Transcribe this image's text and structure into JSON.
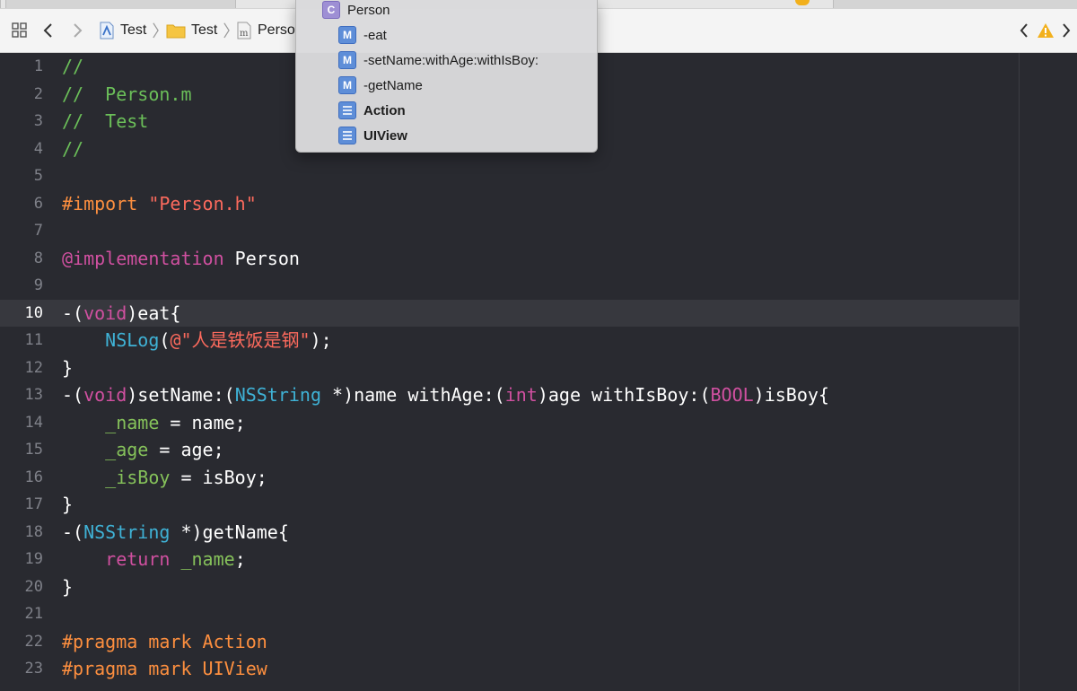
{
  "jumpbar": {
    "crumbs": [
      {
        "label": "Test",
        "icon": "project-icon"
      },
      {
        "label": "Test",
        "icon": "folder-icon"
      },
      {
        "label": "Perso",
        "icon": "m-file-icon"
      }
    ]
  },
  "popup": {
    "items": [
      {
        "label": "Person",
        "kind": "C",
        "icon": "class-icon"
      },
      {
        "label": "-eat",
        "kind": "M",
        "icon": "method-icon"
      },
      {
        "label": "-setName:withAge:withIsBoy:",
        "kind": "M",
        "icon": "method-icon"
      },
      {
        "label": "-getName",
        "kind": "M",
        "icon": "method-icon"
      },
      {
        "label": "Action",
        "kind": "mark",
        "icon": "pragma-mark-icon"
      },
      {
        "label": "UIView",
        "kind": "mark",
        "icon": "pragma-mark-icon"
      }
    ]
  },
  "editor": {
    "current_line": 10,
    "lines": [
      {
        "n": "1",
        "tokens": [
          [
            "//",
            "comment"
          ]
        ]
      },
      {
        "n": "2",
        "tokens": [
          [
            "//  Person.m",
            "comment"
          ]
        ]
      },
      {
        "n": "3",
        "tokens": [
          [
            "//  Test",
            "comment"
          ]
        ]
      },
      {
        "n": "4",
        "tokens": [
          [
            "//",
            "comment"
          ]
        ]
      },
      {
        "n": "5",
        "tokens": []
      },
      {
        "n": "6",
        "tokens": [
          [
            "#import ",
            "pre"
          ],
          [
            "\"Person.h\"",
            "str"
          ]
        ]
      },
      {
        "n": "7",
        "tokens": []
      },
      {
        "n": "8",
        "tokens": [
          [
            "@implementation",
            "kw"
          ],
          [
            " Person",
            "plain"
          ]
        ]
      },
      {
        "n": "9",
        "tokens": []
      },
      {
        "n": "10",
        "tokens": [
          [
            "-(",
            "plain"
          ],
          [
            "void",
            "kw"
          ],
          [
            ")eat{",
            "plain"
          ]
        ]
      },
      {
        "n": "11",
        "tokens": [
          [
            "    ",
            "plain"
          ],
          [
            "NSLog",
            "type"
          ],
          [
            "(",
            "plain"
          ],
          [
            "@\"人是铁饭是钢\"",
            "str"
          ],
          [
            ");",
            "plain"
          ]
        ]
      },
      {
        "n": "12",
        "tokens": [
          [
            "}",
            "plain"
          ]
        ]
      },
      {
        "n": "13",
        "tokens": [
          [
            "-(",
            "plain"
          ],
          [
            "void",
            "kw"
          ],
          [
            ")setName:(",
            "plain"
          ],
          [
            "NSString",
            "type"
          ],
          [
            " *)name withAge:(",
            "plain"
          ],
          [
            "int",
            "kw"
          ],
          [
            ")age withIsBoy:(",
            "plain"
          ],
          [
            "BOOL",
            "kw"
          ],
          [
            ")isBoy{",
            "plain"
          ]
        ]
      },
      {
        "n": "14",
        "tokens": [
          [
            "    ",
            "plain"
          ],
          [
            "_name",
            "ivar"
          ],
          [
            " = name;",
            "plain"
          ]
        ]
      },
      {
        "n": "15",
        "tokens": [
          [
            "    ",
            "plain"
          ],
          [
            "_age",
            "ivar"
          ],
          [
            " = age;",
            "plain"
          ]
        ]
      },
      {
        "n": "16",
        "tokens": [
          [
            "    ",
            "plain"
          ],
          [
            "_isBoy",
            "ivar"
          ],
          [
            " = isBoy;",
            "plain"
          ]
        ]
      },
      {
        "n": "17",
        "tokens": [
          [
            "}",
            "plain"
          ]
        ]
      },
      {
        "n": "18",
        "tokens": [
          [
            "-(",
            "plain"
          ],
          [
            "NSString",
            "type"
          ],
          [
            " *)getName{",
            "plain"
          ]
        ]
      },
      {
        "n": "19",
        "tokens": [
          [
            "    ",
            "plain"
          ],
          [
            "return",
            "kw"
          ],
          [
            " ",
            "plain"
          ],
          [
            "_name",
            "ivar"
          ],
          [
            ";",
            "plain"
          ]
        ]
      },
      {
        "n": "20",
        "tokens": [
          [
            "}",
            "plain"
          ]
        ]
      },
      {
        "n": "21",
        "tokens": []
      },
      {
        "n": "22",
        "tokens": [
          [
            "#pragma mark Action",
            "pre"
          ]
        ]
      },
      {
        "n": "23",
        "tokens": [
          [
            "#pragma mark UIView",
            "pre"
          ]
        ]
      }
    ]
  },
  "colors": {
    "comment": "#6bbf59",
    "preprocessor": "#fd8f3f",
    "string": "#fc6a5d",
    "keyword": "#d050a0",
    "type": "#3fb2d6",
    "ivar": "#85c15a",
    "background": "#292a30",
    "current_line": "#37383e",
    "warning": "#f2b01c"
  }
}
